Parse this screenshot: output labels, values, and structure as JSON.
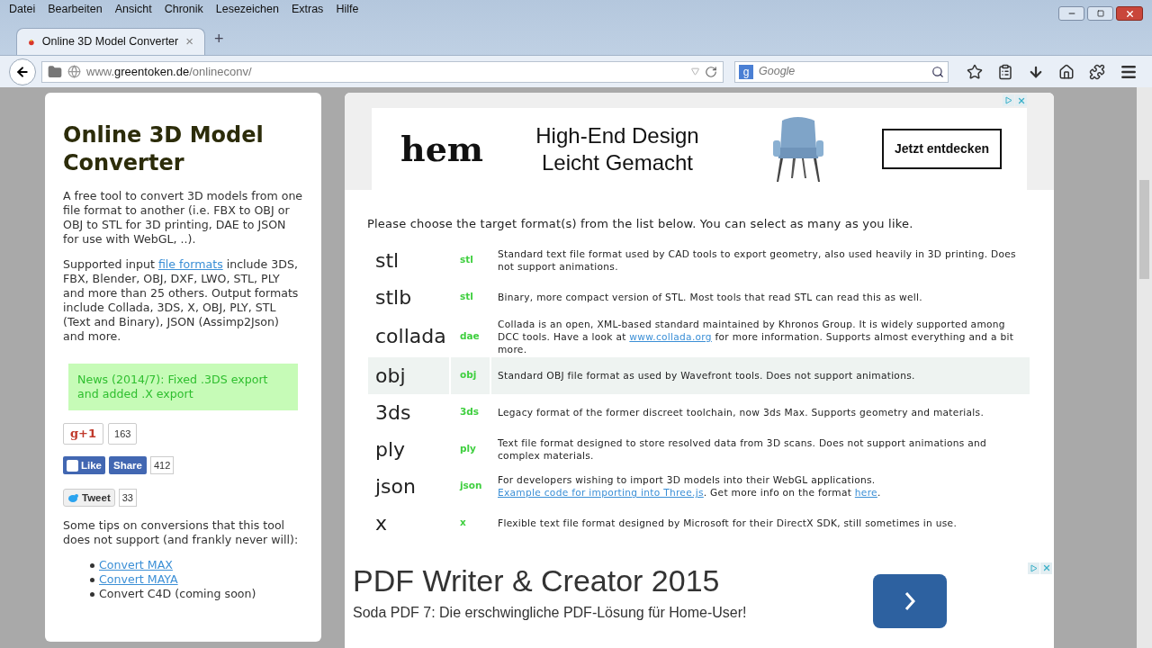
{
  "menu": [
    "Datei",
    "Bearbeiten",
    "Ansicht",
    "Chronik",
    "Lesezeichen",
    "Extras",
    "Hilfe"
  ],
  "tabs": [
    {
      "title": "Online 3D Model Converter",
      "selected": true,
      "close": "×"
    }
  ],
  "new_tab": "+",
  "address": {
    "host_pre": "www.",
    "host": "greentoken.de",
    "path": "/onlineconv/"
  },
  "search": {
    "engine": "g",
    "placeholder": "Google"
  },
  "sidebar": {
    "title": "Online 3D Model Converter",
    "intro": "A free tool to convert 3D models from one file format to another (i.e. FBX to OBJ or OBJ to STL for 3D printing, DAE to JSON for use with WebGL, ..).",
    "supported": [
      {
        "kind": "text",
        "text": "Supported input "
      },
      {
        "kind": "link",
        "text": "file formats"
      },
      {
        "kind": "text",
        "text": " include 3DS, FBX, Blender, OBJ, DXF, LWO, STL, PLY and more than 25 others. Output formats include Collada, 3DS, X, OBJ, PLY, STL (Text and Binary), JSON (Assimp2Json) and more."
      }
    ],
    "news": "News (2014/7): Fixed .3DS export and added .X export",
    "gplus": {
      "logo": "g",
      "label": "+1",
      "count": "163"
    },
    "facebook": {
      "like": "Like",
      "share": "Share",
      "count": "412"
    },
    "twitter": {
      "label": "Tweet",
      "count": "33"
    },
    "tips_intro": "Some tips on conversions that this tool does not support (and frankly never will):",
    "tips": [
      {
        "kind": "link",
        "text": "Convert MAX"
      },
      {
        "kind": "link",
        "text": "Convert MAYA"
      },
      {
        "kind": "text",
        "text": "Convert C4D (coming soon)"
      }
    ]
  },
  "top_ad": {
    "logo": "hem",
    "headline": "High-End Design Leicht Gemacht",
    "button": "Jetzt entdecken"
  },
  "instructions": "Please choose the target format(s) from the list below. You can select as many as you like.",
  "formats": [
    {
      "name": "stl",
      "ext": "stl",
      "selected": false,
      "description": [
        {
          "kind": "text",
          "text": "Standard text file format used by CAD tools to export geometry, also used heavily in 3D printing. Does not support animations."
        }
      ]
    },
    {
      "name": "stlb",
      "ext": "stl",
      "selected": false,
      "description": [
        {
          "kind": "text",
          "text": "Binary, more compact version of STL. Most tools that read STL can read this as well."
        }
      ]
    },
    {
      "name": "collada",
      "ext": "dae",
      "selected": false,
      "description": [
        {
          "kind": "text",
          "text": "Collada is an open, XML-based standard maintained by Khronos Group. It is widely supported among DCC tools. Have a look at "
        },
        {
          "kind": "link",
          "text": "www.collada.org"
        },
        {
          "kind": "text",
          "text": " for more information. Supports almost everything and a bit more."
        }
      ]
    },
    {
      "name": "obj",
      "ext": "obj",
      "selected": true,
      "description": [
        {
          "kind": "text",
          "text": "Standard OBJ file format as used by Wavefront tools. Does not support animations."
        }
      ]
    },
    {
      "name": "3ds",
      "ext": "3ds",
      "selected": false,
      "description": [
        {
          "kind": "text",
          "text": "Legacy format of the former discreet toolchain, now 3ds Max. Supports geometry and materials."
        }
      ]
    },
    {
      "name": "ply",
      "ext": "ply",
      "selected": false,
      "description": [
        {
          "kind": "text",
          "text": "Text file format designed to store resolved data from 3D scans. Does not support animations and complex materials."
        }
      ]
    },
    {
      "name": "json",
      "ext": "json",
      "selected": false,
      "description": [
        {
          "kind": "text",
          "text": "For developers wishing to import 3D models into their WebGL applications. "
        },
        {
          "kind": "link",
          "text": "Example code for importing into Three.js"
        },
        {
          "kind": "text",
          "text": ". Get more info on the format "
        },
        {
          "kind": "link",
          "text": "here"
        },
        {
          "kind": "text",
          "text": "."
        }
      ]
    },
    {
      "name": "x",
      "ext": "x",
      "selected": false,
      "description": [
        {
          "kind": "text",
          "text": "Flexible text file format designed by Microsoft for their DirectX SDK, still sometimes in use."
        }
      ]
    }
  ],
  "bottom_ad": {
    "title": "PDF Writer & Creator 2015",
    "subtitle": "Soda PDF 7: Die erschwingliche PDF-Lösung für Home-User!"
  }
}
